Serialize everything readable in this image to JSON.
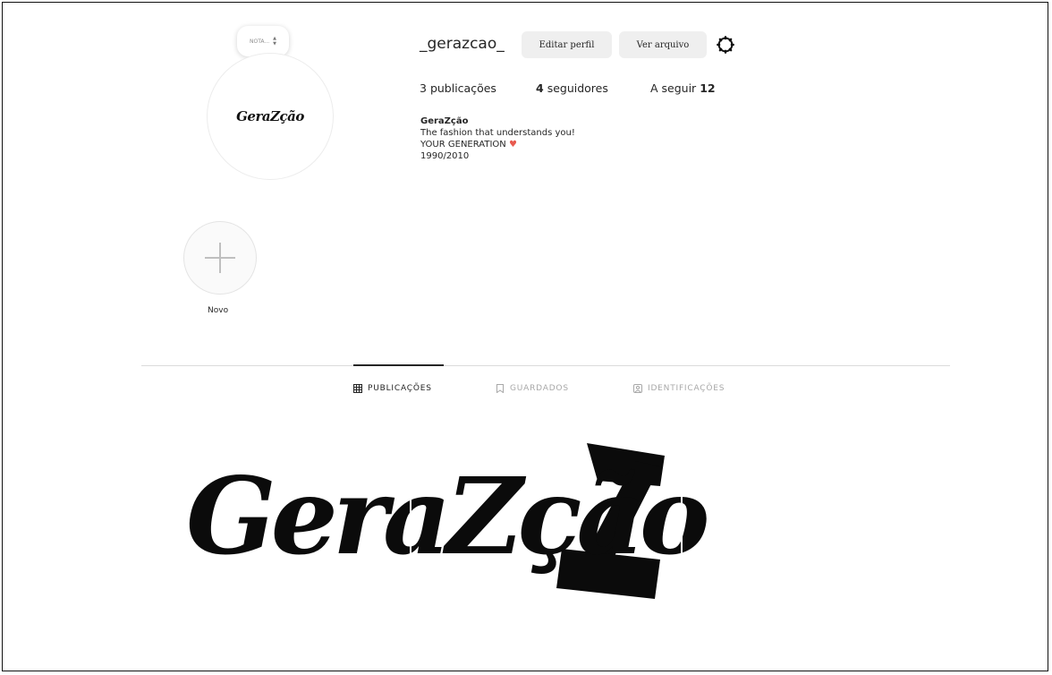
{
  "profile": {
    "note_label": "NOTA...",
    "username": "_gerazcao_",
    "avatar_logo_text": "GeraZção",
    "edit_button": "Editar perfil",
    "archive_button": "Ver arquivo",
    "stats": {
      "posts_count": "3",
      "posts_label": "publicações",
      "followers_count": "4",
      "followers_label": "seguidores",
      "following_label": "A seguir",
      "following_count": "12"
    },
    "bio": {
      "name": "GeraZção",
      "line1": "The fashion that understands you!",
      "line2": "YOUR GENERATION",
      "line3": "1990/2010"
    }
  },
  "highlights": {
    "new_label": "Novo"
  },
  "tabs": [
    {
      "label": "PUBLICAÇÕES",
      "icon": "grid-icon",
      "active": true
    },
    {
      "label": "GUARDADOS",
      "icon": "bookmark-icon",
      "active": false
    },
    {
      "label": "IDENTIFICAÇÕES",
      "icon": "tag-user-icon",
      "active": false
    }
  ],
  "post": {
    "logo_text": "GeraZção"
  },
  "colors": {
    "button_bg": "#efefef",
    "divider": "#dbdbdb",
    "heart": "#e85a4f",
    "inactive_tab": "#a8a8a8"
  }
}
